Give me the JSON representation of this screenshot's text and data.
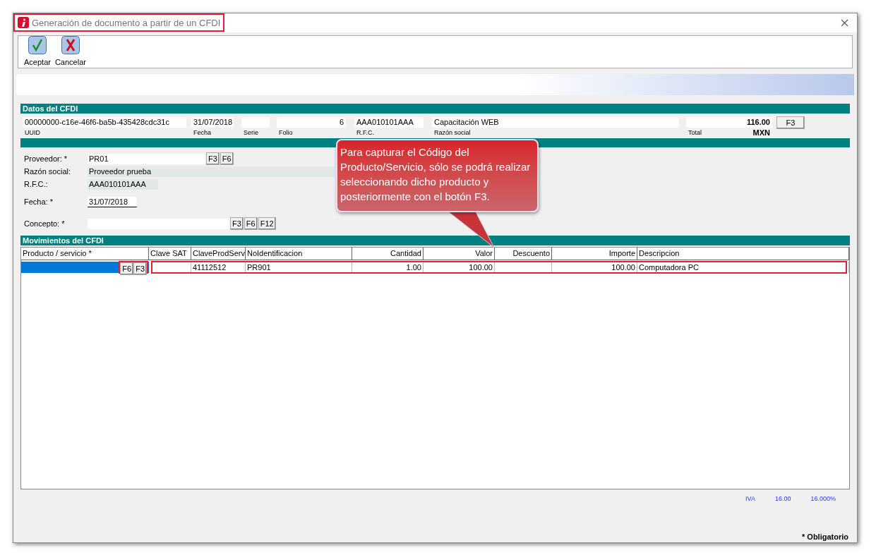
{
  "window": {
    "title": "Generación de documento a partir de un CFDI"
  },
  "toolbar": [
    {
      "kind": "accept",
      "label": "Aceptar"
    },
    {
      "kind": "cancel",
      "label": "Cancelar"
    }
  ],
  "datos": {
    "title": "Datos del CFDI",
    "uuid": {
      "value": "00000000-c16e-46f6-ba5b-435428cdc31c",
      "label": "UUID"
    },
    "fecha": {
      "value": "31/07/2018",
      "label": "Fecha"
    },
    "serie": {
      "label": "Serie"
    },
    "folio": {
      "value": "6",
      "label": "Folio"
    },
    "rfc": {
      "value": "AAA010101AAA",
      "label": "R.F.C."
    },
    "razon": {
      "value": "Capacitación WEB",
      "label": "Razón social"
    },
    "total": {
      "value": "116.00",
      "label": "Total",
      "currency": "MXN",
      "button": "F3"
    }
  },
  "form": {
    "proveedor": {
      "label": "Proveedor: *",
      "value": "PR01",
      "buttons": [
        "F3",
        "F6"
      ]
    },
    "razon": {
      "label": "Razón social:",
      "value": "Proveedor prueba"
    },
    "rfc": {
      "label": "R.F.C.:",
      "value": "AAA010101AAA"
    },
    "fecha": {
      "label": "Fecha: *",
      "value": "31/07/2018"
    },
    "concepto": {
      "label": "Concepto: *",
      "buttons": [
        "F3",
        "F6",
        "F12"
      ]
    }
  },
  "movimientos": {
    "title": "Movimientos del CFDI",
    "columns": [
      {
        "label": "Producto / servicio *",
        "kind": "text"
      },
      {
        "label": "Clave SAT",
        "kind": "text"
      },
      {
        "label": "ClaveProdServ",
        "kind": "text"
      },
      {
        "label": "NoIdentificacion",
        "kind": "text"
      },
      {
        "label": "Cantidad",
        "kind": "number"
      },
      {
        "label": "Valor",
        "kind": "number"
      },
      {
        "label": "Descuento",
        "kind": "number"
      },
      {
        "label": "Importe",
        "kind": "number"
      },
      {
        "label": "Descripcion",
        "kind": "text"
      }
    ],
    "rows": [
      {
        "selected": true,
        "buttons": [
          "F6",
          "F3"
        ],
        "cells": [
          "",
          "",
          "41112512",
          "PR901",
          "1.00",
          "100.00",
          "",
          "100.00",
          "Computadora PC"
        ]
      }
    ]
  },
  "tax": {
    "name": "IVA",
    "amount": "16.00",
    "rate": "16.000%"
  },
  "footer": "* Obligatorio",
  "callout": "Para capturar el Código del Producto/Servicio, sólo se podrá realizar seleccionando dicho producto y posteriormente con el botón F3."
}
